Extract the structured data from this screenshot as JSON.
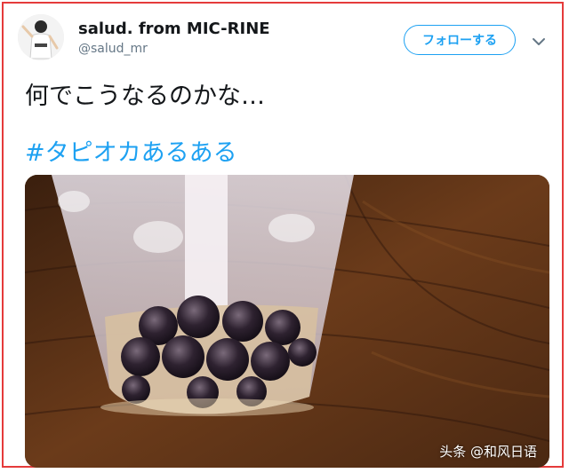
{
  "tweet": {
    "display_name": "salud. from MIC-RINE",
    "handle": "@salud_mr",
    "follow_label": "フォローする",
    "text": "何でこうなるのかな…",
    "hashtag": "#タピオカあるある"
  },
  "media": {
    "watermark": "头条 @和风日语"
  },
  "icons": {
    "menu": "chevron-down-icon"
  },
  "colors": {
    "accent": "#1da1f2",
    "frame": "#e53b3b",
    "name": "#14171a",
    "muted": "#657786"
  }
}
